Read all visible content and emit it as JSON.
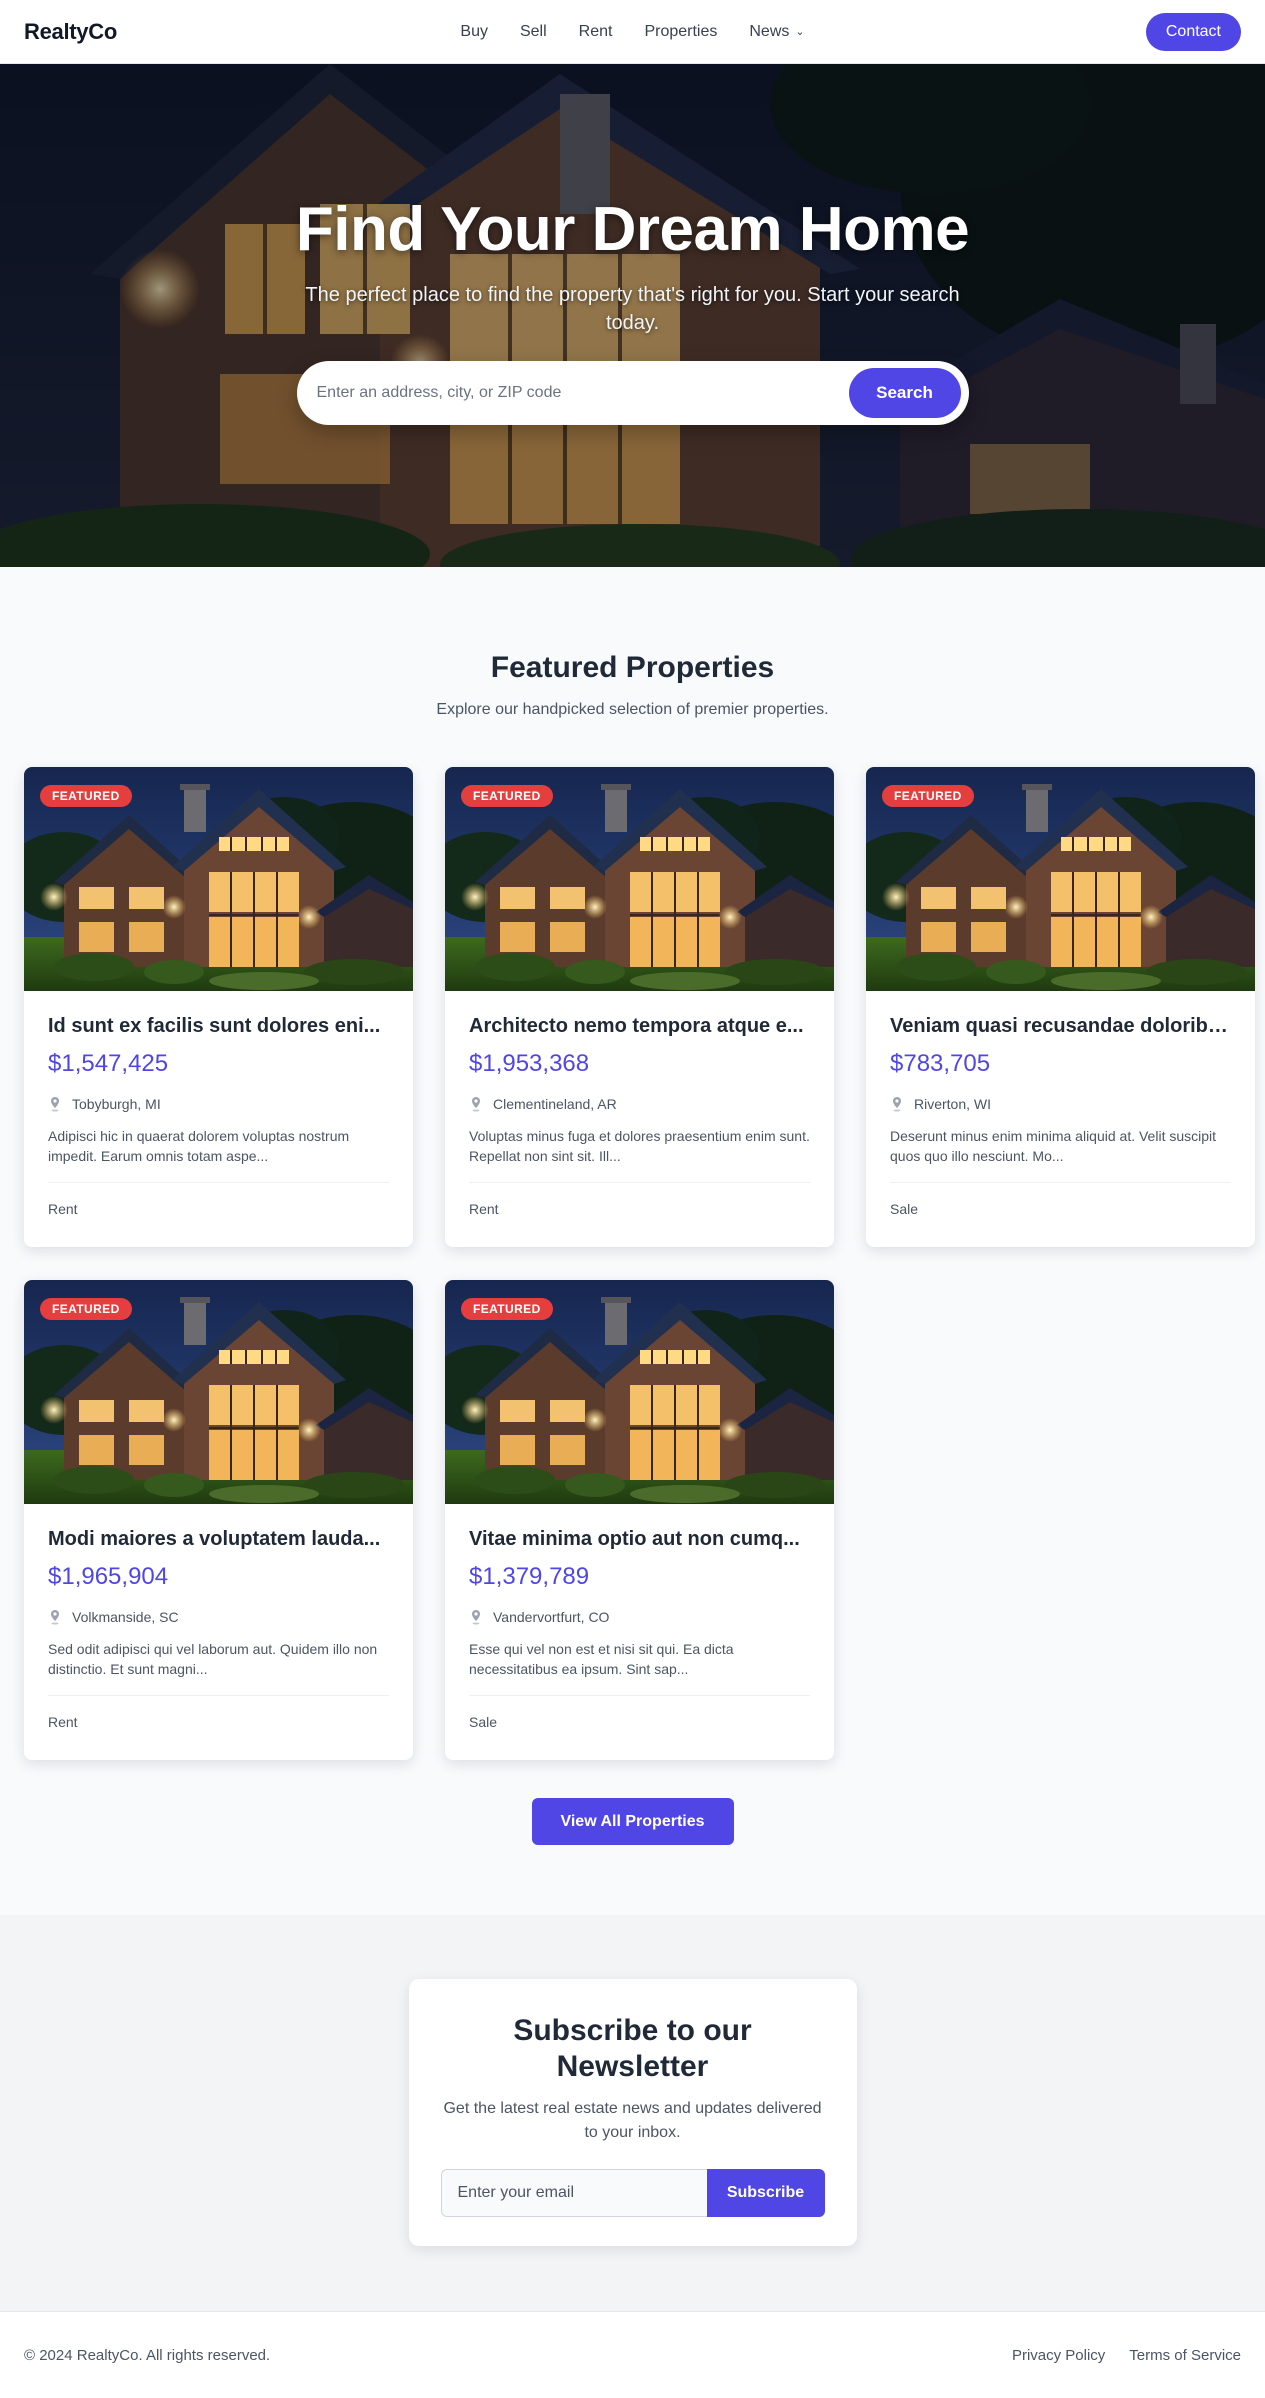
{
  "nav": {
    "brand": "RealtyCo",
    "links": [
      "Buy",
      "Sell",
      "Rent",
      "Properties",
      "News"
    ],
    "contact_label": "Contact"
  },
  "hero": {
    "title": "Find Your Dream Home",
    "subtitle": "The perfect place to find the property that's right for you. Start your search today.",
    "search_placeholder": "Enter an address, city, or ZIP code",
    "search_button": "Search"
  },
  "featured": {
    "title": "Featured Properties",
    "subtitle": "Explore our handpicked selection of premier properties.",
    "badge": "FEATURED",
    "view_all_label": "View All Properties",
    "properties": [
      {
        "title": "Id sunt ex facilis sunt dolores eni...",
        "price": "$1,547,425",
        "location": "Tobyburgh, MI",
        "description": "Adipisci hic in quaerat dolorem voluptas nostrum impedit. Earum omnis totam aspe...",
        "type": "Rent"
      },
      {
        "title": "Architecto nemo tempora atque e...",
        "price": "$1,953,368",
        "location": "Clementineland, AR",
        "description": "Voluptas minus fuga et dolores praesentium enim sunt. Repellat non sint sit. Ill...",
        "type": "Rent"
      },
      {
        "title": "Veniam quasi recusandae doloribu...",
        "price": "$783,705",
        "location": "Riverton, WI",
        "description": "Deserunt minus enim minima aliquid at. Velit suscipit quos quo illo nesciunt. Mo...",
        "type": "Sale"
      },
      {
        "title": "Modi maiores a voluptatem lauda...",
        "price": "$1,965,904",
        "location": "Volkmanside, SC",
        "description": "Sed odit adipisci qui vel laborum aut. Quidem illo non distinctio. Et sunt magni...",
        "type": "Rent"
      },
      {
        "title": "Vitae minima optio aut non cumq...",
        "price": "$1,379,789",
        "location": "Vandervortfurt, CO",
        "description": "Esse qui vel non est et nisi sit qui. Ea dicta necessitatibus ea ipsum. Sint sap...",
        "type": "Sale"
      }
    ]
  },
  "newsletter": {
    "title": "Subscribe to our Newsletter",
    "description": "Get the latest real estate news and updates delivered to your inbox.",
    "email_placeholder": "Enter your email",
    "button": "Subscribe"
  },
  "footer": {
    "copyright": "© 2024 RealtyCo. All rights reserved.",
    "links": [
      "Privacy Policy",
      "Terms of Service"
    ]
  },
  "colors": {
    "accent": "#4f46e5",
    "badge": "#e53e3e",
    "text_dark": "#1f2937",
    "text_muted": "#4b5563"
  },
  "icons": {
    "news_dropdown": "chevron-down-icon",
    "location": "map-pin-icon"
  }
}
